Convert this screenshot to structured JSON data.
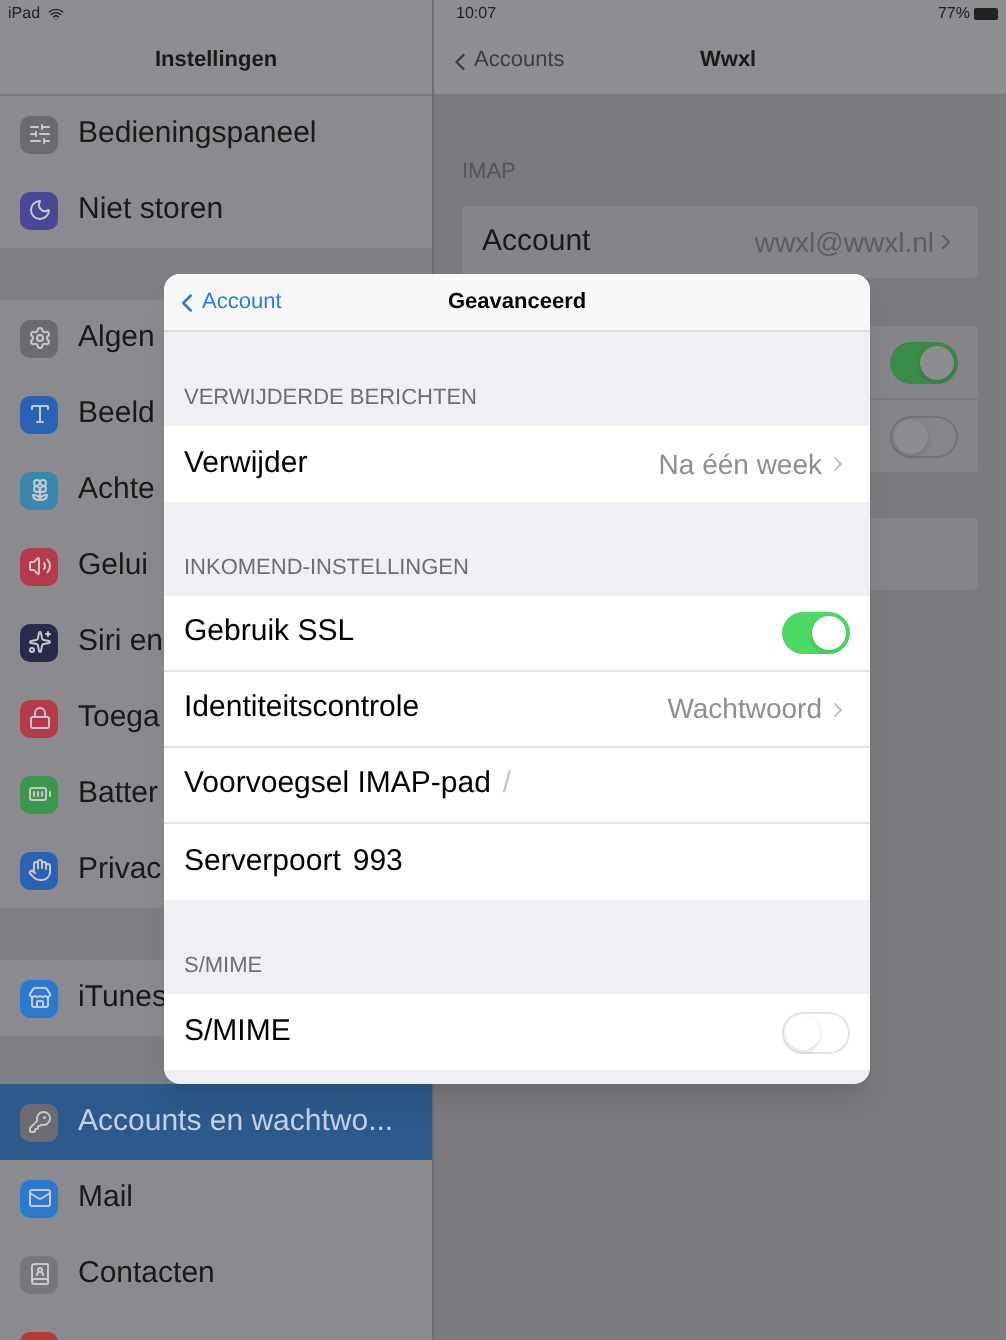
{
  "status_bar": {
    "device": "iPad",
    "time": "10:07",
    "battery": "77%"
  },
  "sidebar": {
    "title": "Instellingen",
    "groups": [
      [
        {
          "label": "Bedieningspaneel",
          "color": "#6c6c70",
          "selected": false
        },
        {
          "label": "Niet storen",
          "color": "#4a4896",
          "selected": false
        }
      ],
      [
        {
          "label": "Algen",
          "color": "#6c6c70",
          "selected": false
        },
        {
          "label": "Beeld",
          "color": "#2a62b4",
          "selected": false
        },
        {
          "label": "Achte",
          "color": "#3a88ae",
          "selected": false
        },
        {
          "label": "Gelui",
          "color": "#b43a4c",
          "selected": false
        },
        {
          "label": "Siri en",
          "color": "#2a2a4a",
          "selected": false
        },
        {
          "label": "Toega",
          "color": "#b43a4c",
          "selected": false
        },
        {
          "label": "Batter",
          "color": "#3b974c",
          "selected": false
        },
        {
          "label": "Privac",
          "color": "#2a62b4",
          "selected": false
        }
      ],
      [
        {
          "label": "iTunes",
          "color": "#2a7ad0",
          "selected": false
        }
      ],
      [
        {
          "label": "Accounts en wachtwo...",
          "color": "#6c6c70",
          "selected": true
        },
        {
          "label": "Mail",
          "color": "#2a7ad0",
          "selected": false
        },
        {
          "label": "Contacten",
          "color": "#77777a",
          "selected": false
        },
        {
          "color": "#b43a3a",
          "selected": false
        }
      ]
    ]
  },
  "detail": {
    "back": "Accounts",
    "title": "Wwxl",
    "section": "IMAP",
    "account_row": {
      "label": "Account",
      "value": "wwxl@wwxl.nl"
    },
    "hidden_toggles": [
      {
        "on": true
      },
      {
        "on": false
      }
    ]
  },
  "modal": {
    "back": "Account",
    "title": "Geavanceerd",
    "sections": [
      {
        "header": "VERWIJDERDE BERICHTEN",
        "rows": [
          {
            "kind": "disclosure",
            "label": "Verwijder",
            "value": "Na één week"
          }
        ]
      },
      {
        "header": "INKOMEND-INSTELLINGEN",
        "rows": [
          {
            "kind": "toggle",
            "label": "Gebruik SSL",
            "on": true
          },
          {
            "kind": "disclosure",
            "label": "Identiteitscontrole",
            "value": "Wachtwoord"
          },
          {
            "kind": "field",
            "label": "Voorvoegsel IMAP-pad",
            "placeholder": "/"
          },
          {
            "kind": "field",
            "label": "Serverpoort",
            "value": "993"
          }
        ]
      },
      {
        "header": "S/MIME",
        "rows": [
          {
            "kind": "toggle",
            "label": "S/MIME",
            "on": false
          }
        ]
      }
    ]
  }
}
